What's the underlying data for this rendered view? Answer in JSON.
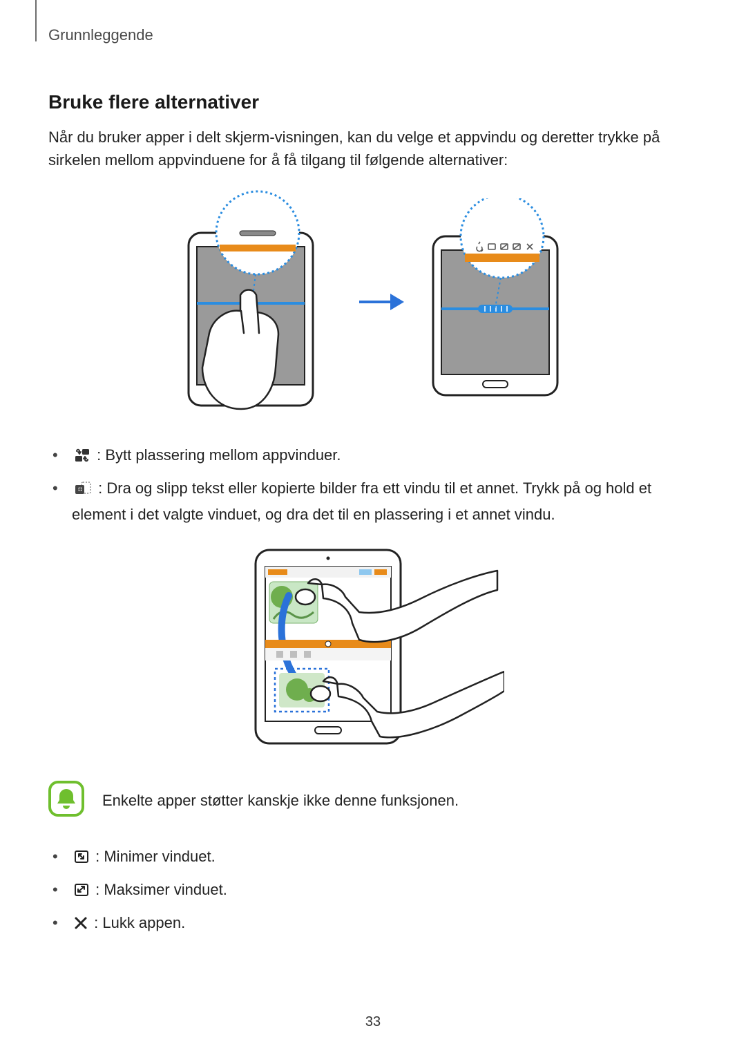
{
  "header": {
    "section": "Grunnleggende"
  },
  "title": "Bruke flere alternativer",
  "intro": "Når du bruker apper i delt skjerm-visningen, kan du velge et appvindu og deretter trykke på sirkelen mellom appvinduene for å få tilgang til følgende alternativer:",
  "icons": {
    "swap": "swap-windows-icon",
    "drag": "drag-content-icon",
    "minimize": "minimize-window-icon",
    "maximize": "maximize-window-icon",
    "close": "close-app-icon",
    "note": "note-bell-icon",
    "arrow": "arrow-right-icon"
  },
  "bullets_top": [
    {
      "icon": "swap",
      "text": ": Bytt plassering mellom appvinduer."
    },
    {
      "icon": "drag",
      "text": ": Dra og slipp tekst eller kopierte bilder fra ett vindu til et annet. Trykk på og hold et element i det valgte vinduet, og dra det til en plassering i et annet vindu."
    }
  ],
  "note": "Enkelte apper støtter kanskje ikke denne funksjonen.",
  "bullets_bottom": [
    {
      "icon": "minimize",
      "text": ": Minimer vinduet."
    },
    {
      "icon": "maximize",
      "text": ": Maksimer vinduet."
    },
    {
      "icon": "close",
      "text": ": Lukk appen."
    }
  ],
  "page_number": "33"
}
